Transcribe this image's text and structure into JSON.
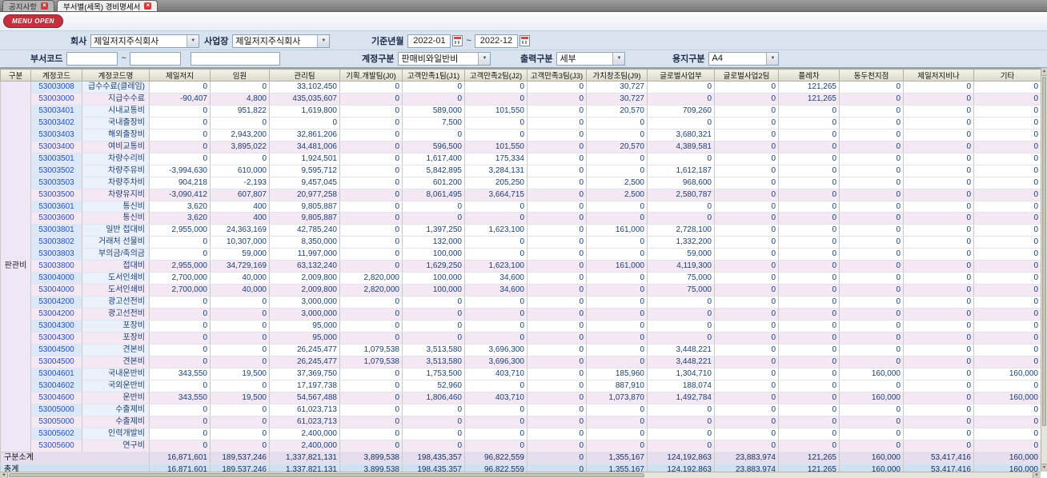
{
  "tabs": [
    {
      "label": "공지사항"
    },
    {
      "label": "부서별(세목) 경비명세서"
    }
  ],
  "menu_open_label": "MENU OPEN",
  "icons": {
    "close": "×",
    "down_arrow": "▼",
    "left_arrow": "◄",
    "right_arrow": "►",
    "up_arrow": "▲"
  },
  "filters": {
    "company_label": "회사",
    "company_value": "제일저지주식회사",
    "site_label": "사업장",
    "site_value": "제일저지주식회사",
    "period_label": "기준년월",
    "period_from": "2022-01",
    "period_to": "2022-12",
    "tilde": "~",
    "dept_code_label": "부서코드",
    "dept_code_from": "",
    "dept_code_to": "",
    "dept_name": "",
    "account_label": "계정구분",
    "account_value": "판매비와일반비",
    "output_label": "출력구분",
    "output_value": "세부",
    "paper_label": "용지구분",
    "paper_value": "A4"
  },
  "colors": {
    "menu_open_bg": "#c5303f",
    "tab_close_bg": "#d43a3a",
    "code_col_bg": "#dbe8fa",
    "sum_row_bg": "#f4e8f4",
    "subtotal_row_bg": "#e6ddee",
    "total_row_bg": "#cfe1f3",
    "group_col_bg": "#efe7f5"
  },
  "grid": {
    "headers": [
      "구분",
      "계정코드",
      "계정코드명",
      "제일저지",
      "임원",
      "관리팀",
      "기획.개발팀(J0)",
      "고객만족1팀(J1)",
      "고객만족2팀(J2)",
      "고객만족3팀(J3)",
      "가치창조팀(J9)",
      "글로벌사업부",
      "글로벌사업2팀",
      "플레차",
      "동두천지점",
      "제일저지비나",
      "기타"
    ],
    "group_label": "판관비",
    "rows": [
      {
        "type": "detail",
        "code": "53003008",
        "name": "급수수료(클레임)",
        "values": [
          "0",
          "0",
          "33,102,450",
          "0",
          "0",
          "0",
          "0",
          "30,727",
          "0",
          "0",
          "121,265",
          "0",
          "0",
          "0"
        ]
      },
      {
        "type": "sum",
        "code": "53003000",
        "name": "지급수수료",
        "values": [
          "-90,407",
          "4,800",
          "435,035,607",
          "0",
          "0",
          "0",
          "0",
          "30,727",
          "0",
          "0",
          "121,265",
          "0",
          "0",
          "0"
        ]
      },
      {
        "type": "detail",
        "code": "53003401",
        "name": "시내교통비",
        "values": [
          "0",
          "951,822",
          "1,619,800",
          "0",
          "589,000",
          "101,550",
          "0",
          "20,570",
          "709,260",
          "0",
          "0",
          "0",
          "0",
          "0"
        ]
      },
      {
        "type": "detail",
        "code": "53003402",
        "name": "국내출장비",
        "values": [
          "0",
          "0",
          "0",
          "0",
          "7,500",
          "0",
          "0",
          "0",
          "0",
          "0",
          "0",
          "0",
          "0",
          "0"
        ]
      },
      {
        "type": "detail",
        "code": "53003403",
        "name": "해외출장비",
        "values": [
          "0",
          "2,943,200",
          "32,861,206",
          "0",
          "0",
          "0",
          "0",
          "0",
          "3,680,321",
          "0",
          "0",
          "0",
          "0",
          "0"
        ]
      },
      {
        "type": "sum",
        "code": "53003400",
        "name": "여비교통비",
        "values": [
          "0",
          "3,895,022",
          "34,481,006",
          "0",
          "596,500",
          "101,550",
          "0",
          "20,570",
          "4,389,581",
          "0",
          "0",
          "0",
          "0",
          "0"
        ]
      },
      {
        "type": "detail",
        "code": "53003501",
        "name": "차량수리비",
        "values": [
          "0",
          "0",
          "1,924,501",
          "0",
          "1,617,400",
          "175,334",
          "0",
          "0",
          "0",
          "0",
          "0",
          "0",
          "0",
          "0"
        ]
      },
      {
        "type": "detail",
        "code": "53003502",
        "name": "차량주유비",
        "values": [
          "-3,994,630",
          "610,000",
          "9,595,712",
          "0",
          "5,842,895",
          "3,284,131",
          "0",
          "0",
          "1,612,187",
          "0",
          "0",
          "0",
          "0",
          "0"
        ]
      },
      {
        "type": "detail",
        "code": "53003503",
        "name": "차량주차비",
        "values": [
          "904,218",
          "-2,193",
          "9,457,045",
          "0",
          "601,200",
          "205,250",
          "0",
          "2,500",
          "968,600",
          "0",
          "0",
          "0",
          "0",
          "0"
        ]
      },
      {
        "type": "sum",
        "code": "53003500",
        "name": "차량유지비",
        "values": [
          "-3,090,412",
          "607,807",
          "20,977,258",
          "0",
          "8,061,495",
          "3,664,715",
          "0",
          "2,500",
          "2,580,787",
          "0",
          "0",
          "0",
          "0",
          "0"
        ]
      },
      {
        "type": "detail",
        "code": "53003601",
        "name": "통신비",
        "values": [
          "3,620",
          "400",
          "9,805,887",
          "0",
          "0",
          "0",
          "0",
          "0",
          "0",
          "0",
          "0",
          "0",
          "0",
          "0"
        ]
      },
      {
        "type": "sum",
        "code": "53003600",
        "name": "통신비",
        "values": [
          "3,620",
          "400",
          "9,805,887",
          "0",
          "0",
          "0",
          "0",
          "0",
          "0",
          "0",
          "0",
          "0",
          "0",
          "0"
        ]
      },
      {
        "type": "detail",
        "code": "53003801",
        "name": "일반 접대비",
        "values": [
          "2,955,000",
          "24,363,169",
          "42,785,240",
          "0",
          "1,397,250",
          "1,623,100",
          "0",
          "161,000",
          "2,728,100",
          "0",
          "0",
          "0",
          "0",
          "0"
        ]
      },
      {
        "type": "detail",
        "code": "53003802",
        "name": "거래처 선물비",
        "values": [
          "0",
          "10,307,000",
          "8,350,000",
          "0",
          "132,000",
          "0",
          "0",
          "0",
          "1,332,200",
          "0",
          "0",
          "0",
          "0",
          "0"
        ]
      },
      {
        "type": "detail",
        "code": "53003803",
        "name": "부의금/축의금",
        "values": [
          "0",
          "59,000",
          "11,997,000",
          "0",
          "100,000",
          "0",
          "0",
          "0",
          "59,000",
          "0",
          "0",
          "0",
          "0",
          "0"
        ]
      },
      {
        "type": "sum",
        "code": "53003800",
        "name": "접대비",
        "values": [
          "2,955,000",
          "34,729,169",
          "63,132,240",
          "0",
          "1,629,250",
          "1,623,100",
          "0",
          "161,000",
          "4,119,300",
          "0",
          "0",
          "0",
          "0",
          "0"
        ]
      },
      {
        "type": "detail",
        "code": "53004000",
        "name": "도서인쇄비",
        "values": [
          "2,700,000",
          "40,000",
          "2,009,800",
          "2,820,000",
          "100,000",
          "34,600",
          "0",
          "0",
          "75,000",
          "0",
          "0",
          "0",
          "0",
          "0"
        ]
      },
      {
        "type": "sum",
        "code": "53004000",
        "name": "도서인쇄비",
        "values": [
          "2,700,000",
          "40,000",
          "2,009,800",
          "2,820,000",
          "100,000",
          "34,600",
          "0",
          "0",
          "75,000",
          "0",
          "0",
          "0",
          "0",
          "0"
        ]
      },
      {
        "type": "detail",
        "code": "53004200",
        "name": "광고선전비",
        "values": [
          "0",
          "0",
          "3,000,000",
          "0",
          "0",
          "0",
          "0",
          "0",
          "0",
          "0",
          "0",
          "0",
          "0",
          "0"
        ]
      },
      {
        "type": "sum",
        "code": "53004200",
        "name": "광고선전비",
        "values": [
          "0",
          "0",
          "3,000,000",
          "0",
          "0",
          "0",
          "0",
          "0",
          "0",
          "0",
          "0",
          "0",
          "0",
          "0"
        ]
      },
      {
        "type": "detail",
        "code": "53004300",
        "name": "포장비",
        "values": [
          "0",
          "0",
          "95,000",
          "0",
          "0",
          "0",
          "0",
          "0",
          "0",
          "0",
          "0",
          "0",
          "0",
          "0"
        ]
      },
      {
        "type": "sum",
        "code": "53004300",
        "name": "포장비",
        "values": [
          "0",
          "0",
          "95,000",
          "0",
          "0",
          "0",
          "0",
          "0",
          "0",
          "0",
          "0",
          "0",
          "0",
          "0"
        ]
      },
      {
        "type": "detail",
        "code": "53004500",
        "name": "견본비",
        "values": [
          "0",
          "0",
          "26,245,477",
          "1,079,538",
          "3,513,580",
          "3,696,300",
          "0",
          "0",
          "3,448,221",
          "0",
          "0",
          "0",
          "0",
          "0"
        ]
      },
      {
        "type": "sum",
        "code": "53004500",
        "name": "견본비",
        "values": [
          "0",
          "0",
          "26,245,477",
          "1,079,538",
          "3,513,580",
          "3,696,300",
          "0",
          "0",
          "3,448,221",
          "0",
          "0",
          "0",
          "0",
          "0"
        ]
      },
      {
        "type": "detail",
        "code": "53004601",
        "name": "국내운반비",
        "values": [
          "343,550",
          "19,500",
          "37,369,750",
          "0",
          "1,753,500",
          "403,710",
          "0",
          "185,960",
          "1,304,710",
          "0",
          "0",
          "160,000",
          "0",
          "160,000"
        ]
      },
      {
        "type": "detail",
        "code": "53004602",
        "name": "국외운반비",
        "values": [
          "0",
          "0",
          "17,197,738",
          "0",
          "52,960",
          "0",
          "0",
          "887,910",
          "188,074",
          "0",
          "0",
          "0",
          "0",
          "0"
        ]
      },
      {
        "type": "sum",
        "code": "53004600",
        "name": "운반비",
        "values": [
          "343,550",
          "19,500",
          "54,567,488",
          "0",
          "1,806,460",
          "403,710",
          "0",
          "1,073,870",
          "1,492,784",
          "0",
          "0",
          "160,000",
          "0",
          "160,000"
        ]
      },
      {
        "type": "detail",
        "code": "53005000",
        "name": "수출제비",
        "values": [
          "0",
          "0",
          "61,023,713",
          "0",
          "0",
          "0",
          "0",
          "0",
          "0",
          "0",
          "0",
          "0",
          "0",
          "0"
        ]
      },
      {
        "type": "sum",
        "code": "53005000",
        "name": "수출제비",
        "values": [
          "0",
          "0",
          "61,023,713",
          "0",
          "0",
          "0",
          "0",
          "0",
          "0",
          "0",
          "0",
          "0",
          "0",
          "0"
        ]
      },
      {
        "type": "detail",
        "code": "53005602",
        "name": "인력개발비",
        "values": [
          "0",
          "0",
          "2,400,000",
          "0",
          "0",
          "0",
          "0",
          "0",
          "0",
          "0",
          "0",
          "0",
          "0",
          "0"
        ]
      },
      {
        "type": "sum",
        "code": "53005600",
        "name": "연구비",
        "values": [
          "0",
          "0",
          "2,400,000",
          "0",
          "0",
          "0",
          "0",
          "0",
          "0",
          "0",
          "0",
          "0",
          "0",
          "0"
        ]
      }
    ],
    "subtotal": {
      "label": "구분소계",
      "values": [
        "16,871,601",
        "189,537,246",
        "1,337,821,131",
        "3,899,538",
        "198,435,357",
        "96,822,559",
        "0",
        "1,355,167",
        "124,192,863",
        "23,883,974",
        "121,265",
        "160,000",
        "53,417,416",
        "160,000"
      ]
    },
    "total": {
      "label": "총계",
      "values": [
        "16,871,601",
        "189,537,246",
        "1,337,821,131",
        "3,899,538",
        "198,435,357",
        "96,822,559",
        "0",
        "1,355,167",
        "124,192,863",
        "23,883,974",
        "121,265",
        "160,000",
        "53,417,416",
        "160,000"
      ]
    }
  }
}
